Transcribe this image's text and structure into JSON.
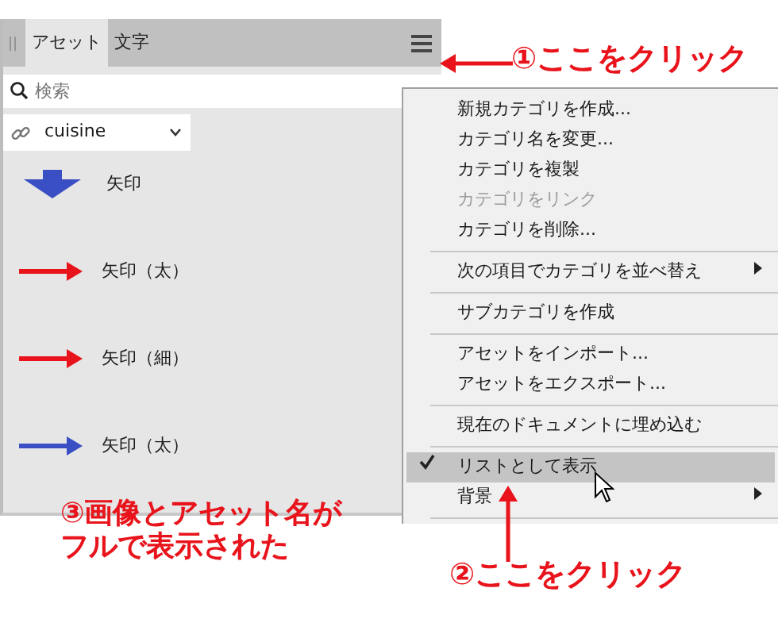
{
  "panel": {
    "grip": "||",
    "tabs": [
      {
        "label": "アセット",
        "selected": true
      },
      {
        "label": "文字",
        "selected": false
      }
    ],
    "search": {
      "placeholder": "検索"
    },
    "category": {
      "value": "cuisine"
    },
    "assets": [
      {
        "name": "矢印",
        "kind": "block-arrow",
        "color": "#3a4fc4"
      },
      {
        "name": "矢印（太）",
        "kind": "arrow",
        "color": "#e8131b"
      },
      {
        "name": "矢印（細）",
        "kind": "arrow",
        "color": "#e8131b"
      },
      {
        "name": "矢印（太）",
        "kind": "arrow",
        "color": "#3a4fc4"
      }
    ]
  },
  "menu": {
    "items": [
      {
        "kind": "item",
        "label": "新規カテゴリを作成...",
        "disabled": false,
        "checked": false,
        "selected": false,
        "submenu": false
      },
      {
        "kind": "item",
        "label": "カテゴリ名を変更...",
        "disabled": false,
        "checked": false,
        "selected": false,
        "submenu": false
      },
      {
        "kind": "item",
        "label": "カテゴリを複製",
        "disabled": false,
        "checked": false,
        "selected": false,
        "submenu": false
      },
      {
        "kind": "item",
        "label": "カテゴリをリンク",
        "disabled": true,
        "checked": false,
        "selected": false,
        "submenu": false
      },
      {
        "kind": "item",
        "label": "カテゴリを削除...",
        "disabled": false,
        "checked": false,
        "selected": false,
        "submenu": false
      },
      {
        "kind": "separator"
      },
      {
        "kind": "item",
        "label": "次の項目でカテゴリを並べ替え",
        "disabled": false,
        "checked": false,
        "selected": false,
        "submenu": true
      },
      {
        "kind": "separator"
      },
      {
        "kind": "item",
        "label": "サブカテゴリを作成",
        "disabled": false,
        "checked": false,
        "selected": false,
        "submenu": false
      },
      {
        "kind": "separator"
      },
      {
        "kind": "item",
        "label": "アセットをインポート...",
        "disabled": false,
        "checked": false,
        "selected": false,
        "submenu": false
      },
      {
        "kind": "item",
        "label": "アセットをエクスポート...",
        "disabled": false,
        "checked": false,
        "selected": false,
        "submenu": false
      },
      {
        "kind": "separator"
      },
      {
        "kind": "item",
        "label": "現在のドキュメントに埋め込む",
        "disabled": false,
        "checked": false,
        "selected": false,
        "submenu": false
      },
      {
        "kind": "separator"
      },
      {
        "kind": "item",
        "label": "リストとして表示",
        "disabled": false,
        "checked": true,
        "selected": true,
        "submenu": false
      },
      {
        "kind": "item",
        "label": "背景",
        "disabled": false,
        "checked": false,
        "selected": false,
        "submenu": true
      },
      {
        "kind": "separator"
      }
    ]
  },
  "annotations": [
    {
      "text": "①ここをクリック"
    },
    {
      "text": "②ここをクリック"
    },
    {
      "lines": [
        "③画像とアセット名が",
        "フルで表示された"
      ]
    }
  ]
}
